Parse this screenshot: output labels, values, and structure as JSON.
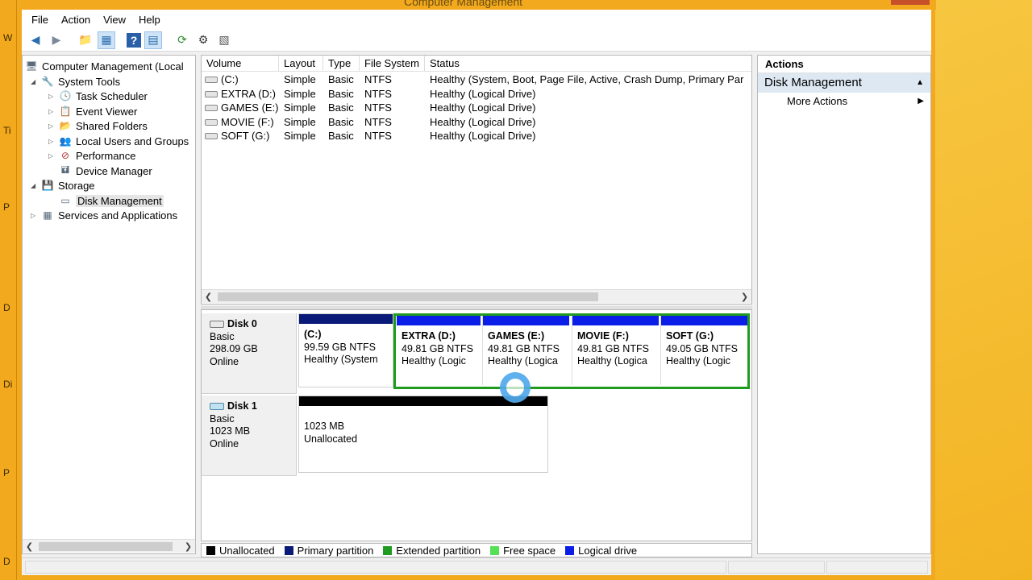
{
  "window": {
    "title": "Computer Management"
  },
  "menu": [
    "File",
    "Action",
    "View",
    "Help"
  ],
  "toolbar": {
    "icons": [
      "back-arrow-icon",
      "forward-arrow-icon",
      "up-folder-icon",
      "show-hide-tree-icon",
      "help-icon",
      "show-action-pane-icon",
      "refresh-icon",
      "properties-icon",
      "settings-icon"
    ]
  },
  "tree": {
    "root": "Computer Management (Local",
    "system_tools": "System Tools",
    "task_scheduler": "Task Scheduler",
    "event_viewer": "Event Viewer",
    "shared_folders": "Shared Folders",
    "local_users": "Local Users and Groups",
    "performance": "Performance",
    "device_manager": "Device Manager",
    "storage": "Storage",
    "disk_management": "Disk Management",
    "services": "Services and Applications"
  },
  "volumes": {
    "headers": [
      "Volume",
      "Layout",
      "Type",
      "File System",
      "Status"
    ],
    "rows": [
      [
        "(C:)",
        "Simple",
        "Basic",
        "NTFS",
        "Healthy (System, Boot, Page File, Active, Crash Dump, Primary Par"
      ],
      [
        "EXTRA (D:)",
        "Simple",
        "Basic",
        "NTFS",
        "Healthy (Logical Drive)"
      ],
      [
        "GAMES (E:)",
        "Simple",
        "Basic",
        "NTFS",
        "Healthy (Logical Drive)"
      ],
      [
        "MOVIE (F:)",
        "Simple",
        "Basic",
        "NTFS",
        "Healthy (Logical Drive)"
      ],
      [
        "SOFT (G:)",
        "Simple",
        "Basic",
        "NTFS",
        "Healthy (Logical Drive)"
      ]
    ]
  },
  "disks": {
    "disk0": {
      "name": "Disk 0",
      "type": "Basic",
      "size": "298.09 GB",
      "state": "Online",
      "partitions": [
        {
          "name": "(C:)",
          "size": "99.59 GB NTFS",
          "status": "Healthy (System"
        },
        {
          "name": "EXTRA  (D:)",
          "size": "49.81 GB NTFS",
          "status": "Healthy (Logic"
        },
        {
          "name": "GAMES  (E:)",
          "size": "49.81 GB NTFS",
          "status": "Healthy (Logica"
        },
        {
          "name": "MOVIE  (F:)",
          "size": "49.81 GB NTFS",
          "status": "Healthy (Logica"
        },
        {
          "name": "SOFT  (G:)",
          "size": "49.05 GB NTFS",
          "status": "Healthy (Logic"
        }
      ]
    },
    "disk1": {
      "name": "Disk 1",
      "type": "Basic",
      "size": "1023 MB",
      "state": "Online",
      "partitions": [
        {
          "size": "1023 MB",
          "status": "Unallocated"
        }
      ]
    }
  },
  "legend": [
    {
      "label": "Unallocated",
      "color": "#000000"
    },
    {
      "label": "Primary partition",
      "color": "#0a1a78"
    },
    {
      "label": "Extended partition",
      "color": "#1f9b1f"
    },
    {
      "label": "Free space",
      "color": "#55e055"
    },
    {
      "label": "Logical drive",
      "color": "#0a1ee8"
    }
  ],
  "actions": {
    "title": "Actions",
    "section": "Disk Management",
    "more": "More Actions"
  },
  "colors": {
    "primary_bar": "#0a1a78",
    "logical_bar": "#0a1ee8",
    "unallocated_bar": "#000000",
    "extended_border": "#1f9b1f"
  }
}
